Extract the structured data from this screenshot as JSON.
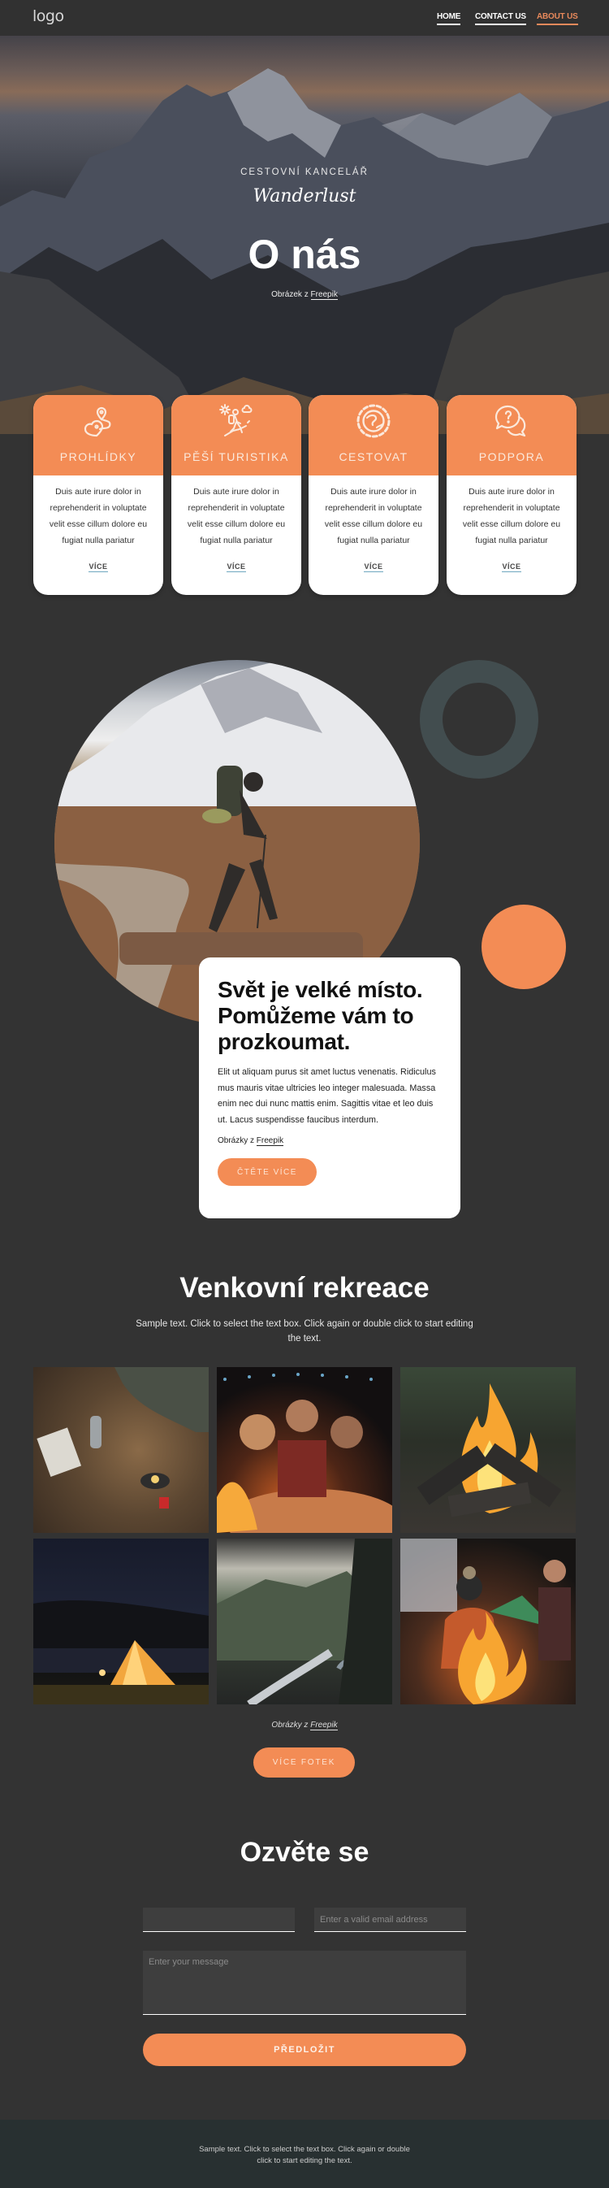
{
  "header": {
    "logo": "logo",
    "nav": [
      {
        "label": "HOME",
        "active": false
      },
      {
        "label": "CONTACT US",
        "active": false
      },
      {
        "label": "ABOUT US",
        "active": true
      }
    ]
  },
  "hero": {
    "tagline": "CESTOVNÍ KANCELÁŘ",
    "script_logo": "Wanderlust",
    "title": "O nás",
    "credit_prefix": "Obrázek z ",
    "credit_link": "Freepik"
  },
  "features": [
    {
      "icon": "map-route-icon",
      "title": "PROHLÍDKY",
      "text": "Duis aute irure dolor in reprehenderit in voluptate velit esse cillum dolore eu fugiat nulla pariatur",
      "link": "VÍCE"
    },
    {
      "icon": "hiker-icon",
      "title": "PĚŠÍ TURISTIKA",
      "text": "Duis aute irure dolor in reprehenderit in voluptate velit esse cillum dolore eu fugiat nulla pariatur",
      "link": "VÍCE"
    },
    {
      "icon": "globe-icon",
      "title": "CESTOVAT",
      "text": "Duis aute irure dolor in reprehenderit in voluptate velit esse cillum dolore eu fugiat nulla pariatur",
      "link": "VÍCE"
    },
    {
      "icon": "support-chat-icon",
      "title": "PODPORA",
      "text": "Duis aute irure dolor in reprehenderit in voluptate velit esse cillum dolore eu fugiat nulla pariatur",
      "link": "VÍCE"
    }
  ],
  "about": {
    "title": "Svět je velké místo. Pomůžeme vám to prozkoumat.",
    "text": "Elit ut aliquam purus sit amet luctus venenatis. Ridiculus mus mauris vitae ultricies leo integer malesuada. Massa enim nec dui nunc mattis enim. Sagittis vitae et leo duis ut. Lacus suspendisse faucibus interdum.",
    "credit_prefix": "Obrázky z ",
    "credit_link": "Freepik",
    "button": "ČTĚTE VÍCE"
  },
  "outdoor": {
    "title": "Venkovní rekreace",
    "subtitle": "Sample text. Click to select the text box. Click again or double click to start editing the text.",
    "gallery": [
      {
        "alt": "friends picnic in forest"
      },
      {
        "alt": "friends roasting marshmallows at fire pit"
      },
      {
        "alt": "campfire logs burning"
      },
      {
        "alt": "lit tent by lake at night"
      },
      {
        "alt": "mountain lake with stream"
      },
      {
        "alt": "couple warming by campfire"
      }
    ],
    "credit_prefix": "Obrázky z ",
    "credit_link": "Freepik",
    "button": "VÍCE FOTEK"
  },
  "contact": {
    "title": "Ozvěte se",
    "name_value": "",
    "name_placeholder": "",
    "email_placeholder": "Enter a valid email address",
    "message_placeholder": "Enter your message",
    "submit": "PŘEDLOŽIT"
  },
  "footer": {
    "text": "Sample text. Click to select the text box. Click again or double click to start editing the text."
  },
  "colors": {
    "accent": "#f38c55",
    "background": "#333333",
    "footer": "#283031",
    "ring": "#424d4f"
  }
}
